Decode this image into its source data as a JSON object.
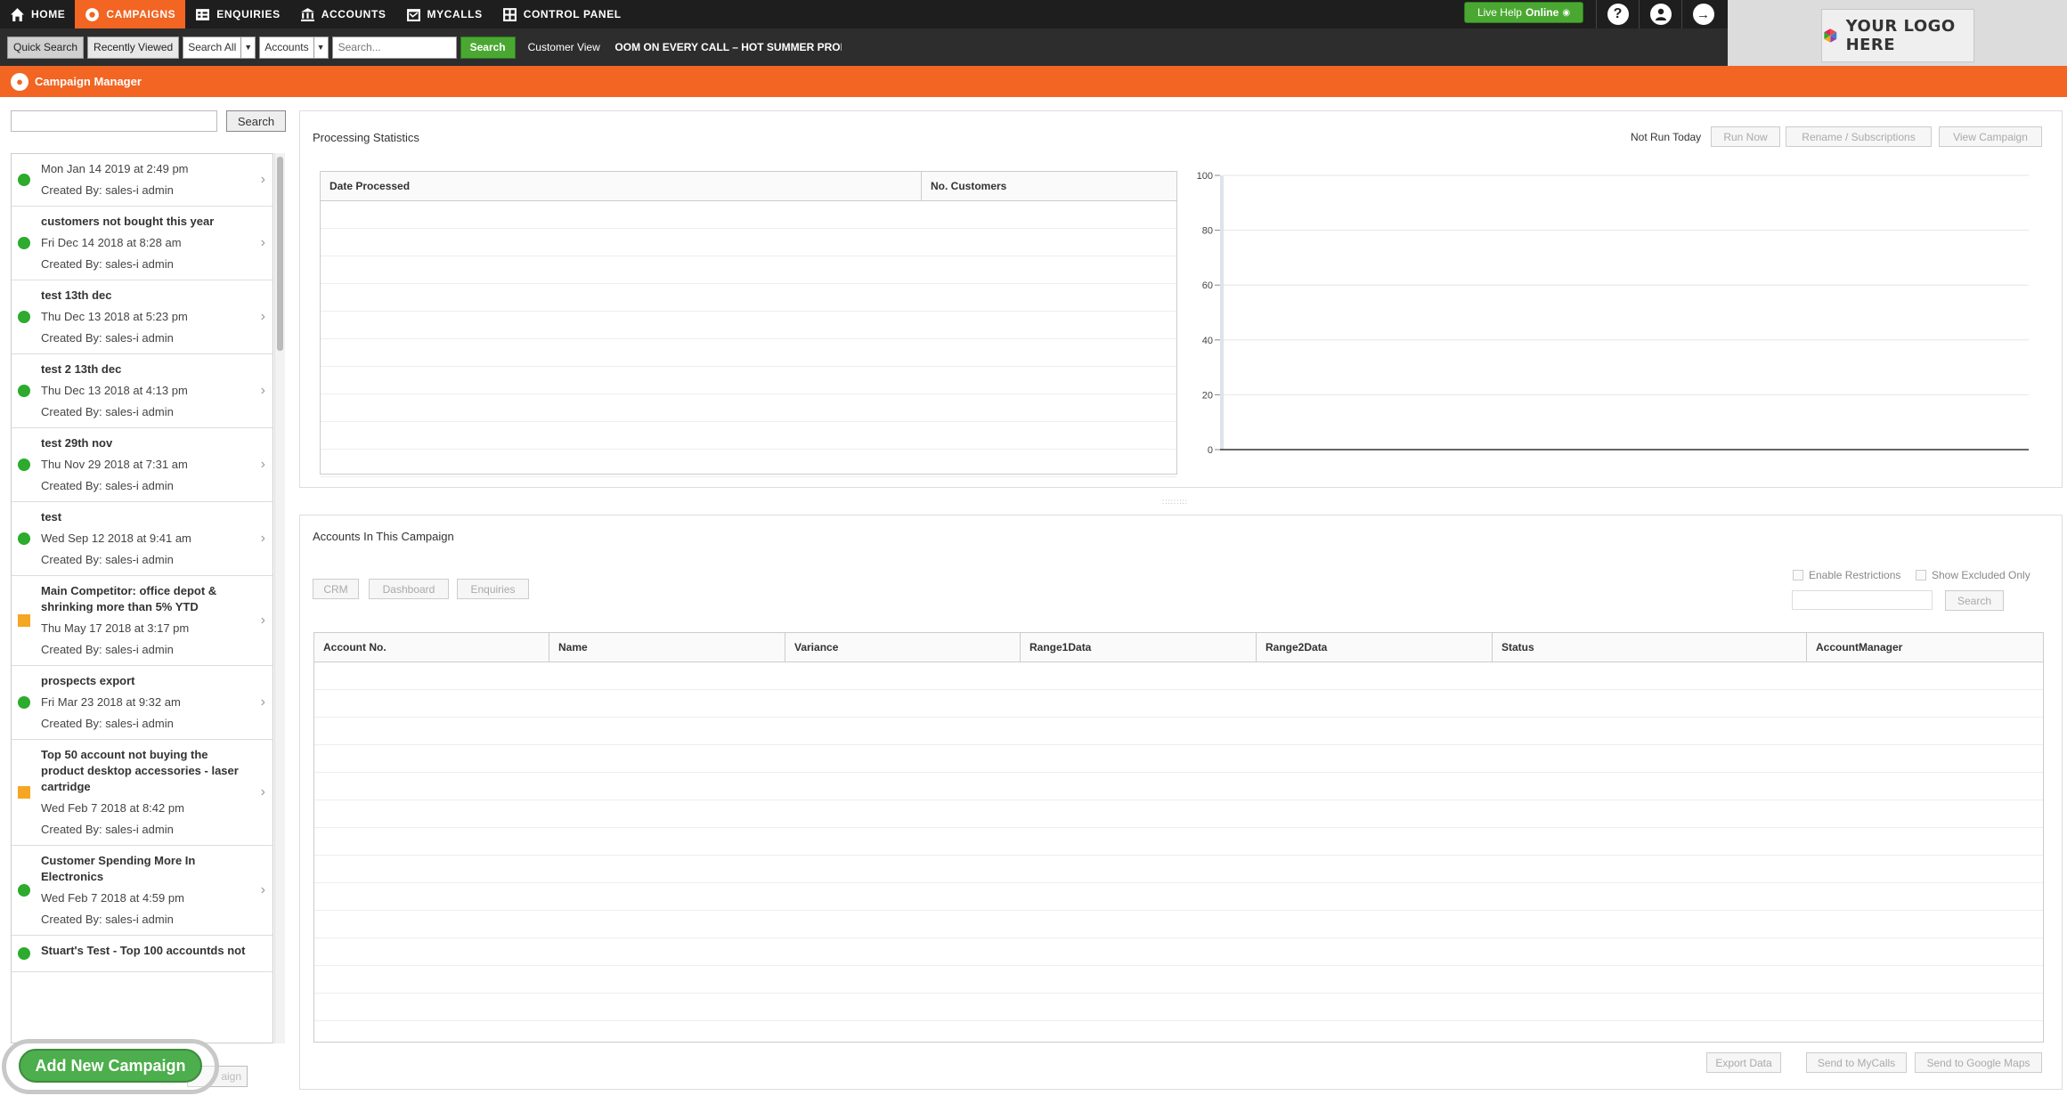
{
  "nav": {
    "items": [
      {
        "label": "HOME",
        "icon": "home-icon",
        "active": false
      },
      {
        "label": "CAMPAIGNS",
        "icon": "campaign-icon",
        "active": true
      },
      {
        "label": "ENQUIRIES",
        "icon": "table-icon",
        "active": false
      },
      {
        "label": "ACCOUNTS",
        "icon": "bank-icon",
        "active": false
      },
      {
        "label": "MYCALLS",
        "icon": "calendar-icon",
        "active": false
      },
      {
        "label": "CONTROL PANEL",
        "icon": "grid-icon",
        "active": false
      }
    ],
    "live_help_prefix": "Live Help",
    "live_help_status": "Online",
    "help_icon": "?",
    "accent_color": "#f26522"
  },
  "searchbar": {
    "quick_search": "Quick Search",
    "recently_viewed": "Recently Viewed",
    "scope_select": "Search All",
    "type_select": "Accounts",
    "placeholder": "Search...",
    "search_button": "Search",
    "customer_view": "Customer View",
    "promo_text": "ROOM ON EVERY CALL – HOT SUMMER PROMOTION"
  },
  "logo": {
    "text": "YOUR LOGO HERE"
  },
  "title_bar": {
    "title": "Campaign Manager"
  },
  "left": {
    "search_button": "Search",
    "campaigns": [
      {
        "name": "",
        "date": "Mon Jan 14 2019 at 2:49 pm",
        "created_by": "Created By: sales-i admin",
        "status": "active"
      },
      {
        "name": "customers not bought this year",
        "date": "Fri Dec 14 2018 at 8:28 am",
        "created_by": "Created By: sales-i admin",
        "status": "active"
      },
      {
        "name": "test 13th dec",
        "date": "Thu Dec 13 2018 at 5:23 pm",
        "created_by": "Created By: sales-i admin",
        "status": "active"
      },
      {
        "name": "test 2 13th dec",
        "date": "Thu Dec 13 2018 at 4:13 pm",
        "created_by": "Created By: sales-i admin",
        "status": "active"
      },
      {
        "name": "test 29th nov",
        "date": "Thu Nov 29 2018 at 7:31 am",
        "created_by": "Created By: sales-i admin",
        "status": "active"
      },
      {
        "name": "test",
        "date": "Wed Sep 12 2018 at 9:41 am",
        "created_by": "Created By: sales-i admin",
        "status": "active"
      },
      {
        "name": "Main Competitor: office depot & shrinking more than 5% YTD",
        "date": "Thu May 17 2018 at 3:17 pm",
        "created_by": "Created By: sales-i admin",
        "status": "warning"
      },
      {
        "name": "prospects export",
        "date": "Fri Mar 23 2018 at 9:32 am",
        "created_by": "Created By: sales-i admin",
        "status": "active"
      },
      {
        "name": "Top 50 account not buying the product desktop accessories - laser cartridge",
        "date": "Wed Feb 7 2018 at 8:42 pm",
        "created_by": "Created By: sales-i admin",
        "status": "warning"
      },
      {
        "name": "Customer Spending More In Electronics",
        "date": "Wed Feb 7 2018 at 4:59 pm",
        "created_by": "Created By: sales-i admin",
        "status": "active"
      },
      {
        "name": "Stuart's Test - Top 100 accountds not",
        "date": "",
        "created_by": "",
        "status": "active"
      }
    ],
    "hidden_button": "aign",
    "add_campaign": "Add New Campaign",
    "status_colors": {
      "active": "#2cab2c",
      "warning": "#f5a623"
    }
  },
  "stats": {
    "title": "Processing Statistics",
    "not_run": "Not Run Today",
    "run_now": "Run Now",
    "rename": "Rename / Subscriptions",
    "view_campaign": "View Campaign",
    "columns": [
      "Date Processed",
      "No. Customers"
    ]
  },
  "chart_data": {
    "type": "bar",
    "categories": [],
    "values": [],
    "title": "",
    "xlabel": "",
    "ylabel": "",
    "ylim": [
      0,
      100
    ],
    "yticks": [
      0,
      20,
      40,
      60,
      80,
      100
    ],
    "grid": true
  },
  "accounts": {
    "title": "Accounts In This Campaign",
    "crm": "CRM",
    "dashboard": "Dashboard",
    "enquiries": "Enquiries",
    "enable_restrictions": "Enable Restrictions",
    "show_excluded": "Show Excluded Only",
    "search": "Search",
    "columns": [
      "Account No.",
      "Name",
      "Variance",
      "Range1Data",
      "Range2Data",
      "Status",
      "AccountManager"
    ],
    "export": "Export Data",
    "send_mycalls": "Send to MyCalls",
    "send_maps": "Send to Google Maps"
  }
}
